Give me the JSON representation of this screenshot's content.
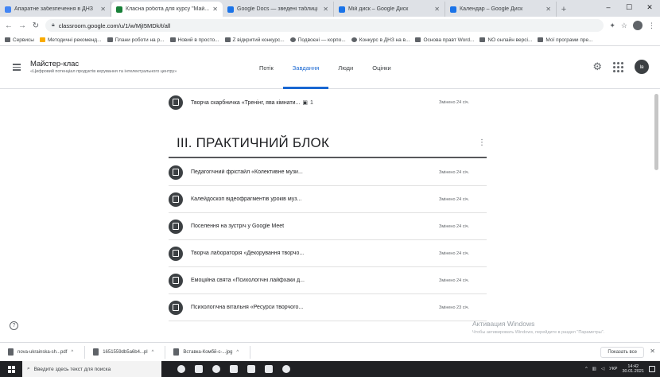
{
  "browser": {
    "tabs": [
      {
        "title": "Апаратне забезпечення в ДНЗ",
        "active": false
      },
      {
        "title": "Класна робота для курсу \"Май...",
        "active": true
      },
      {
        "title": "Google Docs — зведені таблиці",
        "active": false
      },
      {
        "title": "Мій диск – Google Диск",
        "active": false
      },
      {
        "title": "Календар – Google Диск",
        "active": false
      }
    ],
    "address": "classroom.google.com/u/1/w/MjI5MDk/t/all",
    "bookmarks": [
      "Сервисы",
      "Методичні рекоменд...",
      "Плани роботи на р...",
      "Новий в просто...",
      "Z відкритий конкурс...",
      "Подвоєні — корпо...",
      "Конкурс в ДНЗ на в...",
      "Основа правт Word...",
      "NO онлайн версі...",
      "Мої програми пре..."
    ]
  },
  "app": {
    "course_title": "Майстер-клас",
    "course_subtitle": "«Цифровий потенціал продуктів керування та інтелектуального центру»",
    "nav_tabs": [
      "Потік",
      "Завдання",
      "Люди",
      "Оцінки"
    ],
    "active_tab": "Завдання",
    "user_initials": "Ів"
  },
  "main": {
    "top_item": {
      "title": "Творча скарбничка «Тренінг, ява кімнати...",
      "attachments": "1",
      "date": "Змінено 24 січ."
    },
    "section_title": "ІІІ. ПРАКТИЧНИЙ БЛОК",
    "section_more": "⋮",
    "items": [
      {
        "title": "Педагогічний фрістайл «Колективне музи...",
        "date": "Змінено 24 січ."
      },
      {
        "title": "Калейдоскоп відеофрагментів уроків муз...",
        "date": "Змінено 24 січ."
      },
      {
        "title": "Поселення на зустріч у Google Meet",
        "date": "Змінено 24 січ."
      },
      {
        "title": "Творча лабораторія «Декорування творчо...",
        "date": "Змінено 24 січ."
      },
      {
        "title": "Емоційна свята «Психологічні лайфхаки д...",
        "date": "Змінено 24 січ."
      },
      {
        "title": "Психологічна вітальня «Ресурси творчого...",
        "date": "Змінено 23 січ."
      }
    ]
  },
  "watermark": {
    "title": "Активация Windows",
    "text": "Чтобы активировать Windows, перейдите в раздел \"Параметры\"."
  },
  "downloads": {
    "files": [
      "nova-ukrainska-sh...pdf",
      "1651559db5a6b4...pl",
      "Вставка-Комбй-с-...jpg"
    ],
    "show_all": "Показать все"
  },
  "taskbar": {
    "search_placeholder": "Введите здесь текст для поиска",
    "lang": "УКР",
    "time": "14:42",
    "date": "30.01.2021"
  },
  "colors": {
    "accent": "#1967d2",
    "icon_dark": "#3c4043",
    "taskbar": "#202124"
  }
}
